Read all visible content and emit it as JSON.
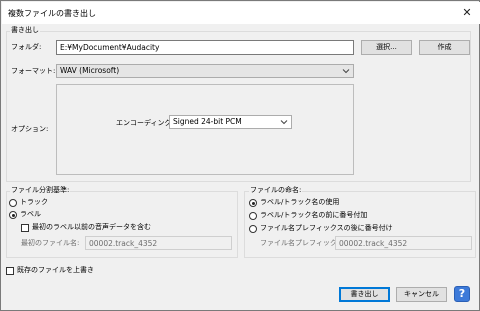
{
  "window": {
    "title": "複数ファイルの書き出し",
    "close_glyph": "✕"
  },
  "export_group": {
    "legend": "書き出し",
    "folder_label": "フォルダ:",
    "folder_value": "E:¥MyDocument¥Audacity",
    "browse_label": "選択...",
    "create_label": "作成",
    "format_label": "フォーマット:",
    "format_value": "WAV (Microsoft)",
    "options_label": "オプション:",
    "encoding_label": "エンコーディング:",
    "encoding_value": "Signed 24-bit PCM"
  },
  "split_group": {
    "legend": "ファイル分割基準:",
    "tracks_label": "トラック",
    "labels_label": "ラベル",
    "labels_selected": true,
    "include_audio_label": "最初のラベル以前の音声データを含む",
    "include_audio_checked": false,
    "first_file_label": "最初のファイル名:",
    "first_file_value": "00002.track_4352"
  },
  "name_group": {
    "legend": "ファイルの命名:",
    "option1": "ラベル/トラック名の使用",
    "option2": "ラベル/トラック名の前に番号付加",
    "option3": "ファイル名プレフィックスの後に番号付け",
    "selected": "option1",
    "prefix_label": "ファイル名プレフィックス:",
    "prefix_value": "00002.track_4352"
  },
  "overwrite": {
    "label": "既存のファイルを上書き",
    "checked": false
  },
  "footer": {
    "export_label": "書き出し",
    "cancel_label": "キャンセル",
    "help_glyph": "?"
  },
  "colors": {
    "accent": "#0078d7",
    "help": "#3d7ad9",
    "background": "#f0f0f0"
  }
}
